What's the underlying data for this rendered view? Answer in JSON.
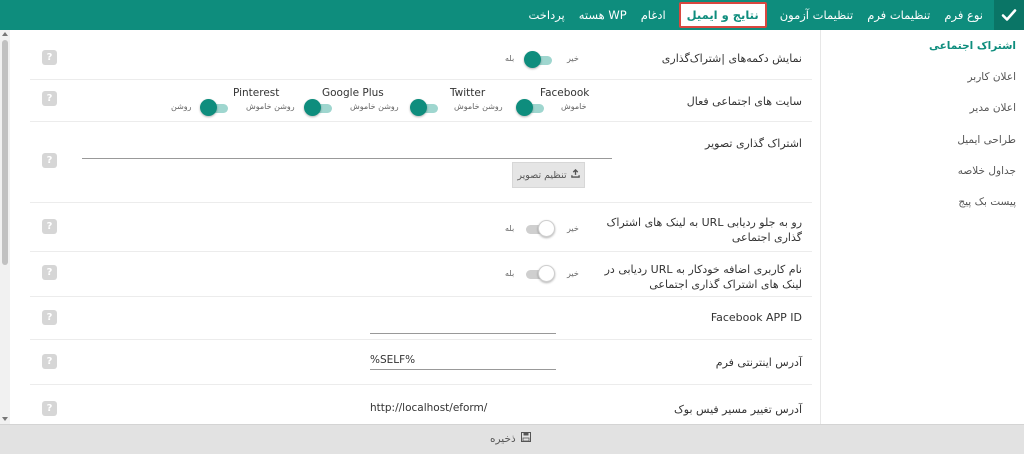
{
  "topbar": {
    "tabs": [
      {
        "label": "نوع فرم",
        "active": false
      },
      {
        "label": "تنظیمات فرم",
        "active": false
      },
      {
        "label": "تنظیمات آزمون",
        "active": false
      },
      {
        "label": "نتایج و ایمیل",
        "active": true
      },
      {
        "label": "ادغام",
        "active": false
      },
      {
        "label": "هسته WP",
        "active": false
      },
      {
        "label": "پرداخت",
        "active": false
      }
    ],
    "accent_color": "#0e8d7d"
  },
  "sidebar": {
    "items": [
      {
        "label": "اشتراک اجتماعی",
        "active": true
      },
      {
        "label": "اعلان کاربر",
        "active": false
      },
      {
        "label": "اعلان مدیر",
        "active": false
      },
      {
        "label": "طراحی ایمیل",
        "active": false
      },
      {
        "label": "جداول خلاصه",
        "active": false
      },
      {
        "label": "پیست بک پیج",
        "active": false
      }
    ]
  },
  "settings": {
    "share_buttons": {
      "label": "نمایش دکمه‌های |شتراک‌گذاری",
      "no": "خیر",
      "yes": "بله",
      "value": true
    },
    "networks": {
      "label": "سایت های اجتماعی فعال",
      "items": [
        {
          "name": "Facebook",
          "state_text": "خاموش",
          "on": true
        },
        {
          "name": "Twitter",
          "state_text": "روشن خاموش",
          "on": true
        },
        {
          "name": "Google Plus",
          "state_text": "روشن خاموش",
          "on": true
        },
        {
          "name": "Pinterest",
          "state_text": "روشن خاموش",
          "on": true
        }
      ],
      "trailing_text": "روشن"
    },
    "share_image": {
      "label": "اشتراک گذاری تصویر",
      "button": "تنظیم تصویر"
    },
    "forward_url": {
      "label": "رو به جلو ردیابی URL به لینک های اشتراک گذاری اجتماعی",
      "no": "خیر",
      "yes": "بله",
      "value": false
    },
    "username_url": {
      "label": "نام کاربری اضافه خودکار به URL ردیابی در لینک های اشتراک گذاری اجتماعی",
      "no": "خیر",
      "yes": "بله",
      "value": false
    },
    "fb_app_id": {
      "label": "Facebook APP ID",
      "value": ""
    },
    "form_url": {
      "label": "آدرس اینترنتی فرم",
      "value": "%SELF%"
    },
    "fb_redirect": {
      "label": "آدرس تغییر مسیر فیس بوک",
      "value": "http://localhost/eform/"
    }
  },
  "footer": {
    "save_label": "ذخیره"
  },
  "icons": {
    "help": "?"
  }
}
